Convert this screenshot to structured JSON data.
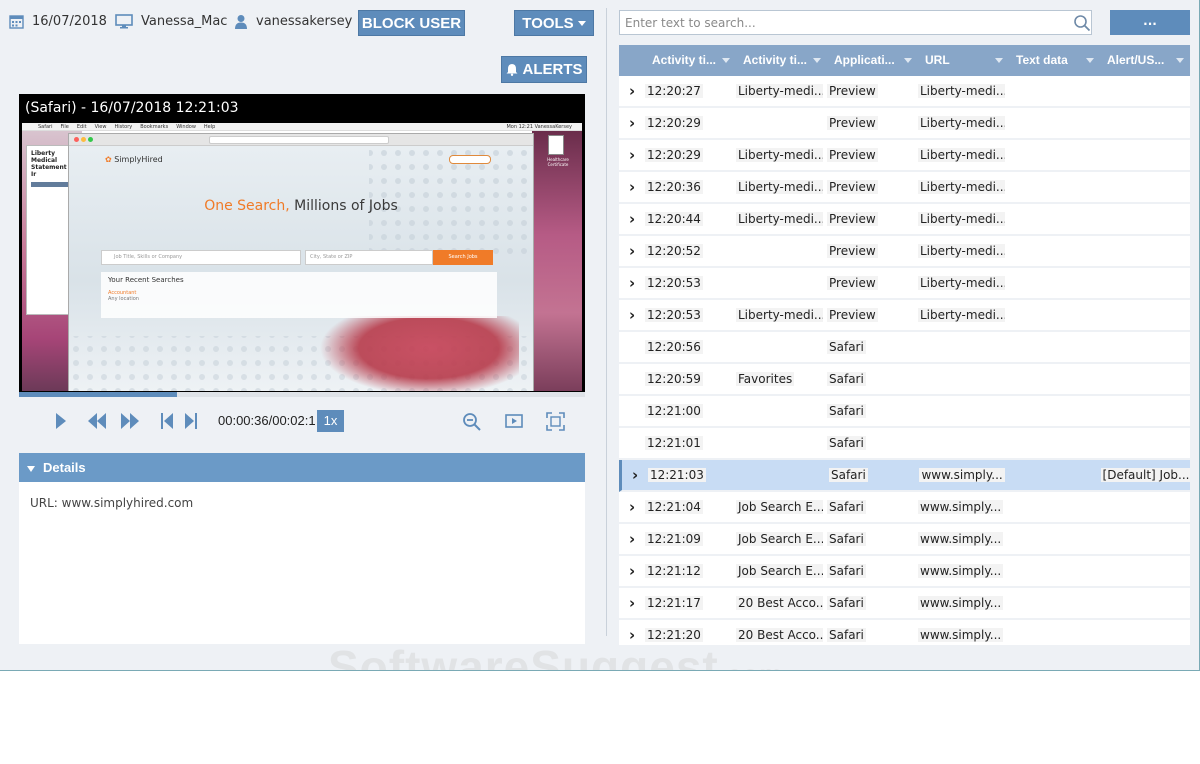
{
  "header": {
    "date": "16/07/2018",
    "computer": "Vanessa_Mac",
    "user": "vanessakersey",
    "block_user_label": "BLOCK USER",
    "tools_label": "TOOLS",
    "alerts_label": "ALERTS"
  },
  "viewer": {
    "title": "(Safari) - 16/07/2018 12:21:03",
    "screenshot": {
      "menubar": [
        "Safari",
        "File",
        "Edit",
        "View",
        "History",
        "Bookmarks",
        "Window",
        "Help"
      ],
      "menubar_right": "Mon 12:21  VanessaKersey",
      "doc_title": "Liberty Medical Statement of Ir",
      "site_logo": "SimplyHired",
      "headline_accent": "One Search,",
      "headline_rest": " Millions of Jobs",
      "search_placeholder": "Job Title, Skills or Company",
      "location_placeholder": "City, State or ZIP",
      "search_button": "Search Jobs",
      "recent_title": "Your Recent Searches",
      "recent_item": "Accountant",
      "recent_loc": "Any location",
      "desktop_file": "Healthcare Certificate"
    }
  },
  "player": {
    "timecode": "00:00:36/00:02:1",
    "speed": "1x",
    "progress": 0.28
  },
  "details": {
    "title": "Details",
    "url_line": "URL: www.simplyhired.com"
  },
  "search": {
    "placeholder": "Enter text to search...",
    "more_label": "..."
  },
  "grid": {
    "columns": [
      "Activity ti...",
      "Activity ti...",
      "Applicati...",
      "URL",
      "Text data",
      "Alert/US..."
    ],
    "rows": [
      {
        "expand": true,
        "time": "12:20:27",
        "title": "Liberty-medi...",
        "app": "Preview",
        "url": "Liberty-medi...",
        "text": "",
        "alert": ""
      },
      {
        "expand": true,
        "time": "12:20:29",
        "title": "",
        "app": "Preview",
        "url": "Liberty-medi...",
        "text": "",
        "alert": ""
      },
      {
        "expand": true,
        "time": "12:20:29",
        "title": "Liberty-medi...",
        "app": "Preview",
        "url": "Liberty-medi...",
        "text": "",
        "alert": ""
      },
      {
        "expand": true,
        "time": "12:20:36",
        "title": "Liberty-medi...",
        "app": "Preview",
        "url": "Liberty-medi...",
        "text": "",
        "alert": ""
      },
      {
        "expand": true,
        "time": "12:20:44",
        "title": "Liberty-medi...",
        "app": "Preview",
        "url": "Liberty-medi...",
        "text": "",
        "alert": ""
      },
      {
        "expand": true,
        "time": "12:20:52",
        "title": "",
        "app": "Preview",
        "url": "Liberty-medi...",
        "text": "",
        "alert": ""
      },
      {
        "expand": true,
        "time": "12:20:53",
        "title": "",
        "app": "Preview",
        "url": "Liberty-medi...",
        "text": "",
        "alert": ""
      },
      {
        "expand": true,
        "time": "12:20:53",
        "title": "Liberty-medi...",
        "app": "Preview",
        "url": "Liberty-medi...",
        "text": "",
        "alert": ""
      },
      {
        "expand": false,
        "time": "12:20:56",
        "title": "",
        "app": "Safari",
        "url": "",
        "text": "",
        "alert": ""
      },
      {
        "expand": false,
        "time": "12:20:59",
        "title": "Favorites",
        "app": "Safari",
        "url": "",
        "text": "",
        "alert": ""
      },
      {
        "expand": false,
        "time": "12:21:00",
        "title": "",
        "app": "Safari",
        "url": "",
        "text": "",
        "alert": ""
      },
      {
        "expand": false,
        "time": "12:21:01",
        "title": "",
        "app": "Safari",
        "url": "",
        "text": "",
        "alert": ""
      },
      {
        "expand": true,
        "selected": true,
        "time": "12:21:03",
        "title": "",
        "app": "Safari",
        "url": "www.simply...",
        "text": "",
        "alert": "[Default] Job..."
      },
      {
        "expand": true,
        "time": "12:21:04",
        "title": "Job Search E...",
        "app": "Safari",
        "url": "www.simply...",
        "text": "",
        "alert": ""
      },
      {
        "expand": true,
        "time": "12:21:09",
        "title": "Job Search E...",
        "app": "Safari",
        "url": "www.simply...",
        "text": "",
        "alert": ""
      },
      {
        "expand": true,
        "time": "12:21:12",
        "title": "Job Search E...",
        "app": "Safari",
        "url": "www.simply...",
        "text": "",
        "alert": ""
      },
      {
        "expand": true,
        "time": "12:21:17",
        "title": "20 Best Acco...",
        "app": "Safari",
        "url": "www.simply...",
        "text": "",
        "alert": ""
      },
      {
        "expand": true,
        "time": "12:21:20",
        "title": "20 Best Acco...",
        "app": "Safari",
        "url": "www.simply...",
        "text": "",
        "alert": ""
      }
    ]
  },
  "watermark": {
    "main": "SoftwareSuggest",
    "suffix": ".com"
  },
  "colors": {
    "accent": "#5e8cbb",
    "header": "#88a6c8",
    "selected_row": "#c8dcf4",
    "site_accent": "#f07b28"
  }
}
